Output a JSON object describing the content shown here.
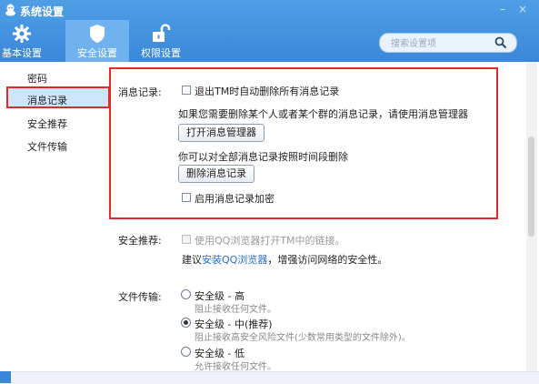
{
  "window": {
    "title": "系统设置",
    "minimize": "–",
    "close": "×"
  },
  "tabs": [
    {
      "label": "基本设置",
      "icon": "gear-icon"
    },
    {
      "label": "安全设置",
      "icon": "shield-icon"
    },
    {
      "label": "权限设置",
      "icon": "unlock-icon"
    }
  ],
  "search": {
    "placeholder": "搜索设置项"
  },
  "sidebar": {
    "items": [
      {
        "label": "密码"
      },
      {
        "label": "消息记录"
      },
      {
        "label": "安全推荐"
      },
      {
        "label": "文件传输"
      }
    ]
  },
  "message_record": {
    "section_label": "消息记录:",
    "auto_delete_label": "退出TM时自动删除所有消息记录",
    "manager_hint": "如果您需要删除某个人或者某个群的消息记录，请使用消息管理器",
    "open_manager_button": "打开消息管理器",
    "delete_hint": "你可以对全部消息记录按照时间段删除",
    "delete_button": "删除消息记录",
    "encrypt_label": "启用消息记录加密"
  },
  "security_recommend": {
    "section_label": "安全推荐:",
    "use_qq_browser_label": "使用QQ浏览器打开TM中的链接。",
    "suggest_prefix": "建议",
    "suggest_link": "安装QQ浏览器",
    "suggest_suffix": "，增强访问网络的安全性。"
  },
  "file_transfer": {
    "section_label": "文件传输:",
    "options": [
      {
        "title": "安全级 - 高",
        "desc": "阻止接收任何文件。",
        "selected": false
      },
      {
        "title": "安全级 - 中(推荐)",
        "desc": "阻止接收高安全风险文件(少数常用类型的文件除外)。",
        "selected": true
      },
      {
        "title": "安全级 - 低",
        "desc": "允许接收任何文件。",
        "selected": false
      }
    ]
  },
  "colors": {
    "header": "#3a87d8",
    "highlight_border": "#e12a2a",
    "selected_bg": "#cde6fb",
    "link": "#2a6fc9"
  }
}
